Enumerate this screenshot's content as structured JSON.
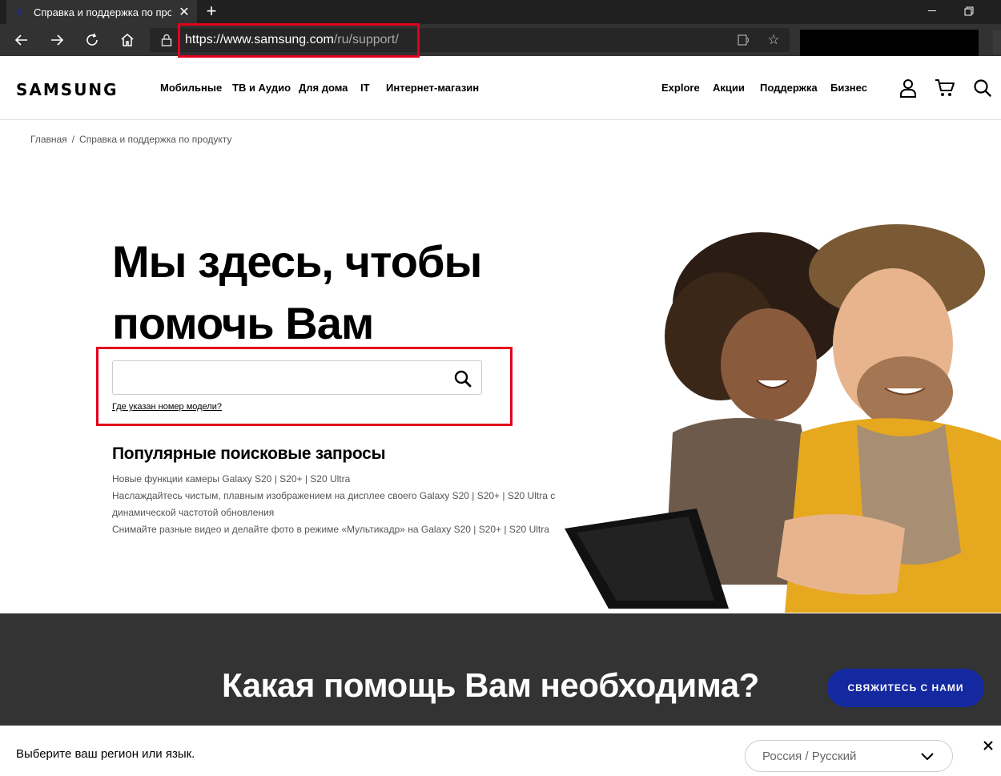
{
  "browser": {
    "tab_title": "Справка и поддержка по продукту",
    "url_host": "https://www.samsung.com",
    "url_path": "/ru/support/"
  },
  "header": {
    "logo": "SAMSUNG",
    "nav_left": [
      "Мобильные",
      "ТВ и Аудио",
      "Для дома",
      "IT",
      "Интернет-магазин"
    ],
    "nav_right": [
      "Explore",
      "Акции",
      "Поддержка",
      "Бизнес"
    ]
  },
  "breadcrumb": {
    "home": "Главная",
    "separator": "/",
    "current": "Справка и поддержка по продукту"
  },
  "hero": {
    "title": "Мы здесь, чтобы помочь Вам",
    "search_value": "",
    "model_link": "Где указан номер модели?"
  },
  "popular": {
    "title": "Популярные поисковые запросы",
    "items": [
      "Новые функции камеры Galaxy S20 | S20+ | S20 Ultra",
      "Наслаждайтесь чистым, плавным изображением на дисплее своего Galaxy S20 | S20+ | S20 Ultra с динамической частотой обновления",
      "Снимайте разные видео и делайте фото в режиме «Мультикадр» на Galaxy S20 | S20+ | S20 Ultra"
    ]
  },
  "help": {
    "title": "Какая помощь Вам необходима?",
    "contact_button": "СВЯЖИТЕСЬ С НАМИ"
  },
  "region": {
    "prompt": "Выберите ваш регион или язык.",
    "selected": "Россия / Русский"
  },
  "colors": {
    "accent": "#1428a0",
    "highlight": "#e3001b",
    "dark_section": "#333333"
  }
}
